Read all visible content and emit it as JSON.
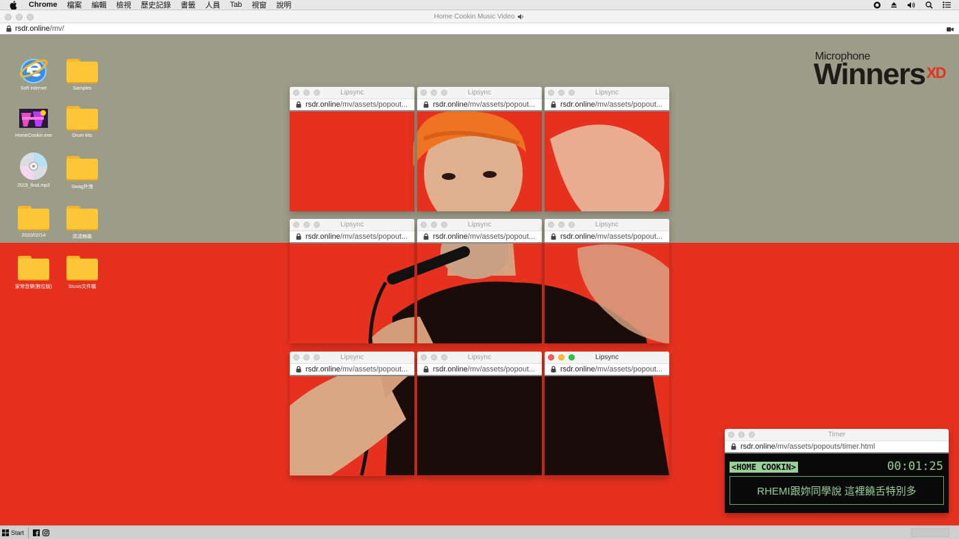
{
  "menubar": {
    "app": "Chrome",
    "items": [
      "檔案",
      "編輯",
      "檢視",
      "歷史記錄",
      "書籤",
      "人員",
      "Tab",
      "視窗",
      "說明"
    ]
  },
  "window": {
    "title": "Home Cookin Music Video",
    "url_host": "rsdr.online",
    "url_path": "/mv/"
  },
  "desktop": {
    "icons": [
      {
        "label": "Soft internet",
        "icon": "internet-icon"
      },
      {
        "label": "Samples",
        "icon": "folder-icon"
      },
      {
        "label": "HomeCookin.exe",
        "icon": "app-icon"
      },
      {
        "label": "Drum kits",
        "icon": "folder-icon"
      },
      {
        "label": "2019_final.mp3",
        "icon": "cd-icon"
      },
      {
        "label": "Swag外洩",
        "icon": "folder-icon"
      },
      {
        "label": "2020/02/14",
        "icon": "folder-icon"
      },
      {
        "label": "高清無碼",
        "icon": "folder-icon"
      },
      {
        "label": "家常音樂(數位版)",
        "icon": "folder-icon"
      },
      {
        "label": "Stusis文件檔",
        "icon": "folder-icon"
      }
    ]
  },
  "logo": {
    "line1": "Microphone",
    "line2": "Winners",
    "suffix": "XD"
  },
  "popups": {
    "title": "Lipsync",
    "url_host": "rsdr.online",
    "url_path": "/mv/assets/popout..."
  },
  "timer": {
    "title": "Timer",
    "url_host": "rsdr.online",
    "url_path": "/mv/assets/popouts/timer.html",
    "badge": "<HOME COOKIN>",
    "time": "00:01:25",
    "lyric": "RHEMI跟妳同學說 這裡饒舌特別多"
  },
  "taskbar": {
    "start_label": "Start"
  },
  "colors": {
    "red": "#e7311f",
    "olive": "#9c9d89",
    "terminal_green": "#9ad19a"
  }
}
